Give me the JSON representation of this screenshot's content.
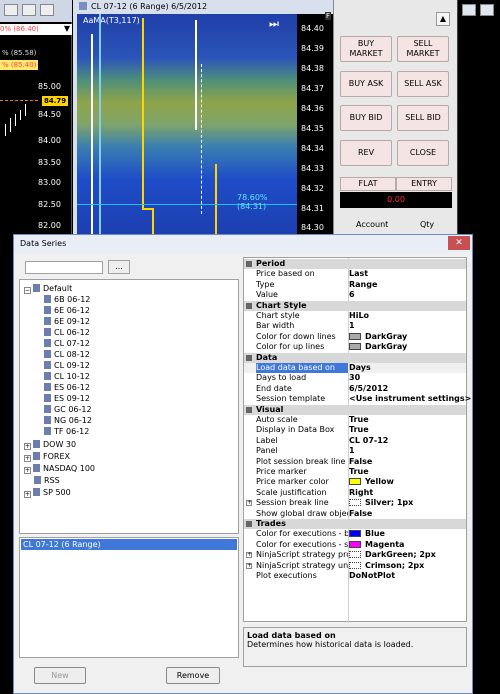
{
  "left_chart": {
    "top_labels": [
      {
        "text": "0% (86.40)",
        "color": "#ff4040"
      },
      {
        "text": "% (85.58)",
        "color": "#ffffff"
      },
      {
        "text": "% (85.40)",
        "color": "#ff4040"
      }
    ],
    "prices": [
      "85.00",
      "84.50",
      "84.00",
      "83.50",
      "83.00",
      "82.50",
      "82.00"
    ],
    "current_price": "84.79"
  },
  "main_chart": {
    "title": "CL 07-12 (6 Range)  6/5/2012",
    "indicator_label": "AaMA(T3,117)",
    "percent_label": "78.60% (84.31)",
    "prices": [
      "84.40",
      "84.39",
      "84.38",
      "84.37",
      "84.36",
      "84.35",
      "84.34",
      "84.33",
      "84.32",
      "84.31",
      "84.30"
    ]
  },
  "order_panel": {
    "buy_market": "BUY MARKET",
    "sell_market": "SELL MARKET",
    "buy_ask": "BUY ASK",
    "sell_ask": "SELL ASK",
    "buy_bid": "BUY BID",
    "sell_bid": "SELL BID",
    "rev": "REV",
    "close": "CLOSE",
    "flat": "FLAT",
    "entry": "ENTRY",
    "pnl": "0.00",
    "account": "Account",
    "qty": "Qty"
  },
  "dialog": {
    "title": "Data Series",
    "close_glyph": "✕",
    "browse_label": "...",
    "new_label": "New",
    "remove_label": "Remove",
    "tree": {
      "default_label": "Default",
      "default_items": [
        "6B 06-12",
        "6E 06-12",
        "6E 09-12",
        "CL 06-12",
        "CL 07-12",
        "CL 08-12",
        "CL 09-12",
        "CL 10-12",
        "ES 06-12",
        "ES 09-12",
        "GC 06-12",
        "NG 06-12",
        "TF 06-12"
      ],
      "groups": [
        "DOW 30",
        "FOREX",
        "NASDAQ 100",
        "RSS",
        "SP 500"
      ]
    },
    "selected_series": "CL 07-12 (6 Range)",
    "properties": [
      {
        "category": "Period",
        "rows": [
          {
            "key": "Price based on",
            "value": "Last"
          },
          {
            "key": "Type",
            "value": "Range"
          },
          {
            "key": "Value",
            "value": "6"
          }
        ]
      },
      {
        "category": "Chart Style",
        "rows": [
          {
            "key": "Chart style",
            "value": "HiLo"
          },
          {
            "key": "Bar width",
            "value": "1"
          },
          {
            "key": "Color for down lines",
            "value": "DarkGray",
            "swatch": "#a9a9a9"
          },
          {
            "key": "Color for up lines",
            "value": "DarkGray",
            "swatch": "#a9a9a9"
          }
        ]
      },
      {
        "category": "Data",
        "rows": [
          {
            "key": "Load data based on",
            "value": "Days",
            "selected": true
          },
          {
            "key": "Days to load",
            "value": "30"
          },
          {
            "key": "End date",
            "value": "6/5/2012"
          },
          {
            "key": "Session template",
            "value": "<Use instrument settings>"
          }
        ]
      },
      {
        "category": "Visual",
        "rows": [
          {
            "key": "Auto scale",
            "value": "True"
          },
          {
            "key": "Display in Data Box",
            "value": "True"
          },
          {
            "key": "Label",
            "value": "CL 07-12"
          },
          {
            "key": "Panel",
            "value": "1"
          },
          {
            "key": "Plot session break line",
            "value": "False"
          },
          {
            "key": "Price marker",
            "value": "True"
          },
          {
            "key": "Price marker color",
            "value": "Yellow",
            "swatch": "#ffff00"
          },
          {
            "key": "Scale justification",
            "value": "Right"
          },
          {
            "key": "Session break line",
            "value": "Silver; 1px",
            "swatch": "#ffffff",
            "expander": true
          },
          {
            "key": "Show global draw objects",
            "value": "False"
          }
        ]
      },
      {
        "category": "Trades",
        "rows": [
          {
            "key": "Color for executions - buy",
            "value": "Blue",
            "swatch": "#0000ff"
          },
          {
            "key": "Color for executions - sell",
            "value": "Magenta",
            "swatch": "#ff00ff"
          },
          {
            "key": "NinjaScript strategy profit",
            "value": "DarkGreen; 2px",
            "swatch": "#ffffff",
            "expander": true
          },
          {
            "key": "NinjaScript strategy unprc",
            "value": "Crimson; 2px",
            "swatch": "#ffffff",
            "expander": true
          },
          {
            "key": "Plot executions",
            "value": "DoNotPlot"
          }
        ]
      }
    ],
    "description": {
      "title": "Load data based on",
      "body": "Determines how historical data is loaded."
    }
  }
}
